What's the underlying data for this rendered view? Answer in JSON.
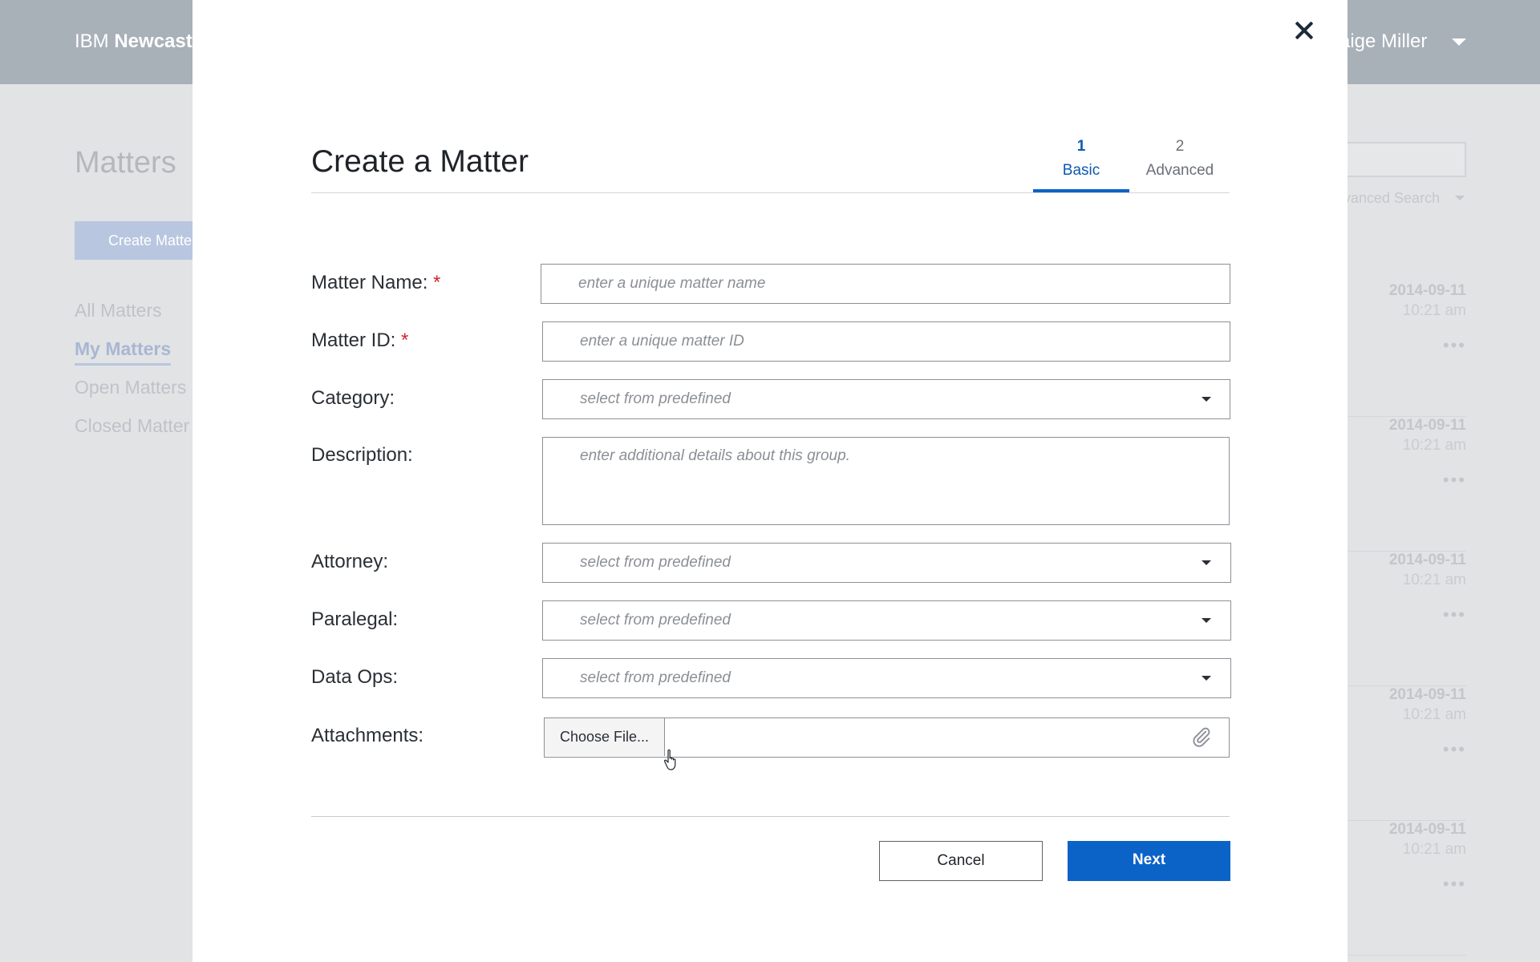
{
  "background": {
    "brand_prefix": "IBM",
    "brand_name": "Newcast",
    "user_name": "aige Miller",
    "page_title": "Matters",
    "create_button": "Create Matte",
    "nav": [
      {
        "label": "All Matters"
      },
      {
        "label": "My Matters"
      },
      {
        "label": "Open Matters"
      },
      {
        "label": "Closed Matter"
      }
    ],
    "advanced_search": "vanced Search",
    "rows": [
      {
        "date": "2014-09-11",
        "time": "10:21 am",
        "menu": "•••"
      },
      {
        "date": "2014-09-11",
        "time": "10:21 am",
        "menu": "•••"
      },
      {
        "date": "2014-09-11",
        "time": "10:21 am",
        "menu": "•••"
      },
      {
        "date": "2014-09-11",
        "time": "10:21 am",
        "menu": "•••"
      },
      {
        "date": "2014-09-11",
        "time": "10:21 am",
        "menu": "•••"
      }
    ]
  },
  "modal": {
    "title": "Create a Matter",
    "steps": [
      {
        "number": "1",
        "label": "Basic",
        "active": true
      },
      {
        "number": "2",
        "label": "Advanced",
        "active": false
      }
    ],
    "fields": {
      "matter_name": {
        "label": "Matter Name:",
        "required_mark": "*",
        "placeholder": "enter a unique matter name"
      },
      "matter_id": {
        "label": "Matter ID:",
        "required_mark": "*",
        "placeholder": "enter a unique matter ID"
      },
      "category": {
        "label": "Category:",
        "placeholder": "select from predefined"
      },
      "description": {
        "label": "Description:",
        "placeholder": "enter additional details about this group."
      },
      "attorney": {
        "label": "Attorney:",
        "placeholder": "select from predefined"
      },
      "paralegal": {
        "label": "Paralegal:",
        "placeholder": "select from predefined"
      },
      "data_ops": {
        "label": "Data Ops:",
        "placeholder": "select from predefined"
      },
      "attachments": {
        "label": "Attachments:",
        "button": "Choose File..."
      }
    },
    "buttons": {
      "cancel": "Cancel",
      "next": "Next"
    }
  },
  "colors": {
    "accent": "#0c63c7",
    "required": "#d0252e"
  },
  "icons": {
    "close": "close-icon",
    "select": "chevron-down-icon",
    "attachment": "paperclip-icon",
    "cursor": "hand-pointer-icon"
  }
}
